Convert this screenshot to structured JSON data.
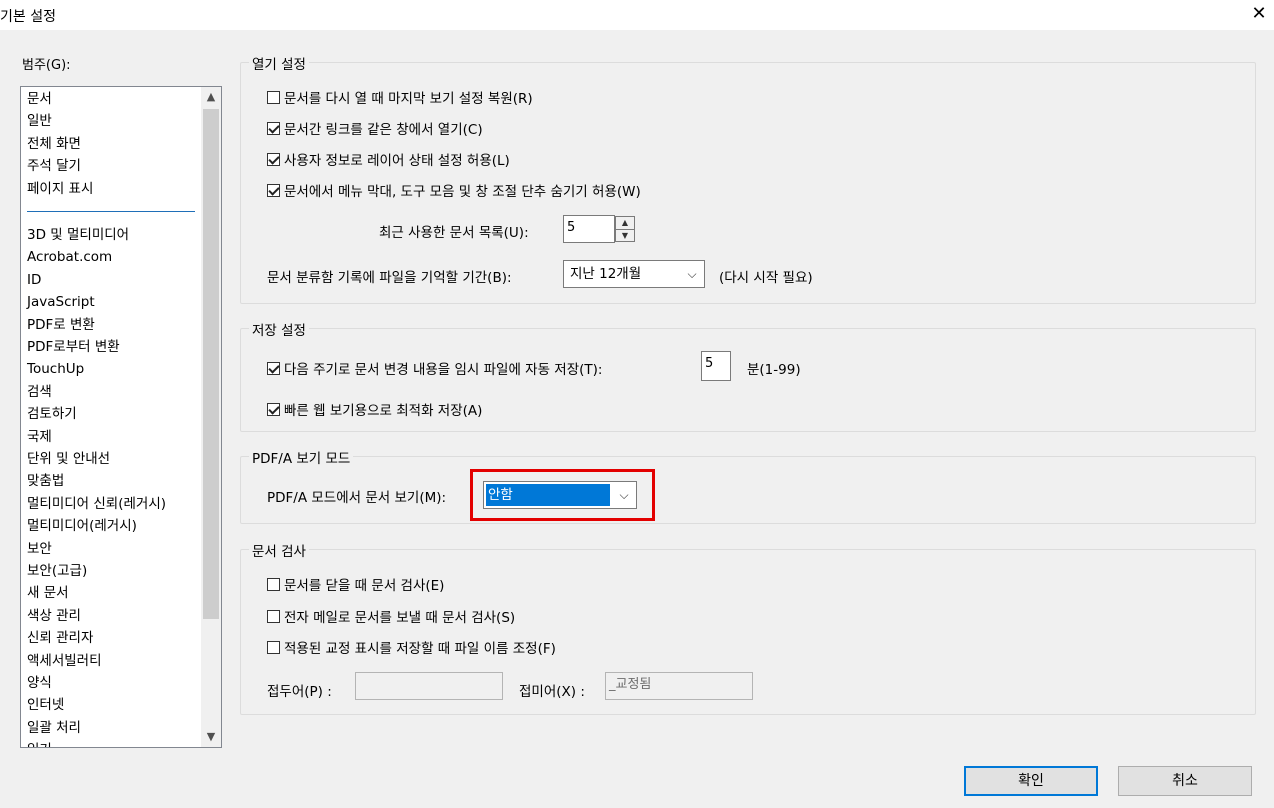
{
  "window": {
    "title": "기본 설정",
    "close_glyph": "✕"
  },
  "category": {
    "label": "범주(G):",
    "items": [
      "문서",
      "일반",
      "전체 화면",
      "주석 달기",
      "페이지 표시",
      "3D 및 멀티미디어",
      "Acrobat.com",
      "ID",
      "JavaScript",
      "PDF로 변환",
      "PDF로부터 변환",
      "TouchUp",
      "검색",
      "검토하기",
      "국제",
      "단위 및 안내선",
      "맞춤법",
      "멀티미디어 신뢰(레거시)",
      "멀티미디어(레거시)",
      "보안",
      "보안(고급)",
      "새 문서",
      "색상 관리",
      "신뢰 관리자",
      "액세서빌러티",
      "양식",
      "인터넷",
      "일괄 처리",
      "읽기"
    ],
    "selected": "문서"
  },
  "open_settings": {
    "legend": "열기 설정",
    "checkboxes": [
      {
        "label": "문서를 다시 열 때 마지막 보기 설정 복원(R)",
        "checked": false
      },
      {
        "label": "문서간 링크를 같은 창에서 열기(C)",
        "checked": true
      },
      {
        "label": "사용자 정보로 레이어 상태 설정 허용(L)",
        "checked": true
      },
      {
        "label": "문서에서 메뉴 막대, 도구 모음 및 창 조절 단추 숨기기 허용(W)",
        "checked": true
      }
    ],
    "recent_label": "최근 사용한 문서 목록(U):",
    "recent_value": "5",
    "history_label": "문서 분류함 기록에 파일을 기억할 기간(B):",
    "history_value": "지난 12개월",
    "restart_note": "(다시 시작 필요)"
  },
  "save_settings": {
    "legend": "저장 설정",
    "autosave_label": "다음 주기로 문서 변경 내용을 임시 파일에 자동 저장(T):",
    "autosave_checked": true,
    "autosave_value": "5",
    "autosave_unit": "분(1-99)",
    "fast_web_label": "빠른 웹 보기용으로 최적화 저장(A)",
    "fast_web_checked": true
  },
  "pdfa": {
    "legend": "PDF/A 보기 모드",
    "label": "PDF/A 모드에서 문서 보기(M):",
    "value": "안함"
  },
  "doc_check": {
    "legend": "문서 검사",
    "checkboxes": [
      {
        "label": "문서를 닫을 때 문서 검사(E)",
        "checked": false
      },
      {
        "label": "전자 메일로 문서를 보낼 때 문서 검사(S)",
        "checked": false
      },
      {
        "label": "적용된 교정 표시를 저장할 때 파일 이름 조정(F)",
        "checked": false
      }
    ],
    "prefix_label": "접두어(P) :",
    "prefix_value": "",
    "suffix_label": "접미어(X) :",
    "suffix_value": "_교정됨"
  },
  "buttons": {
    "ok": "확인",
    "cancel": "취소"
  },
  "icons": {
    "chevron_down": "⌵",
    "scroll_up": "▲",
    "scroll_down": "▼",
    "spin_up": "▲",
    "spin_down": "▼"
  }
}
